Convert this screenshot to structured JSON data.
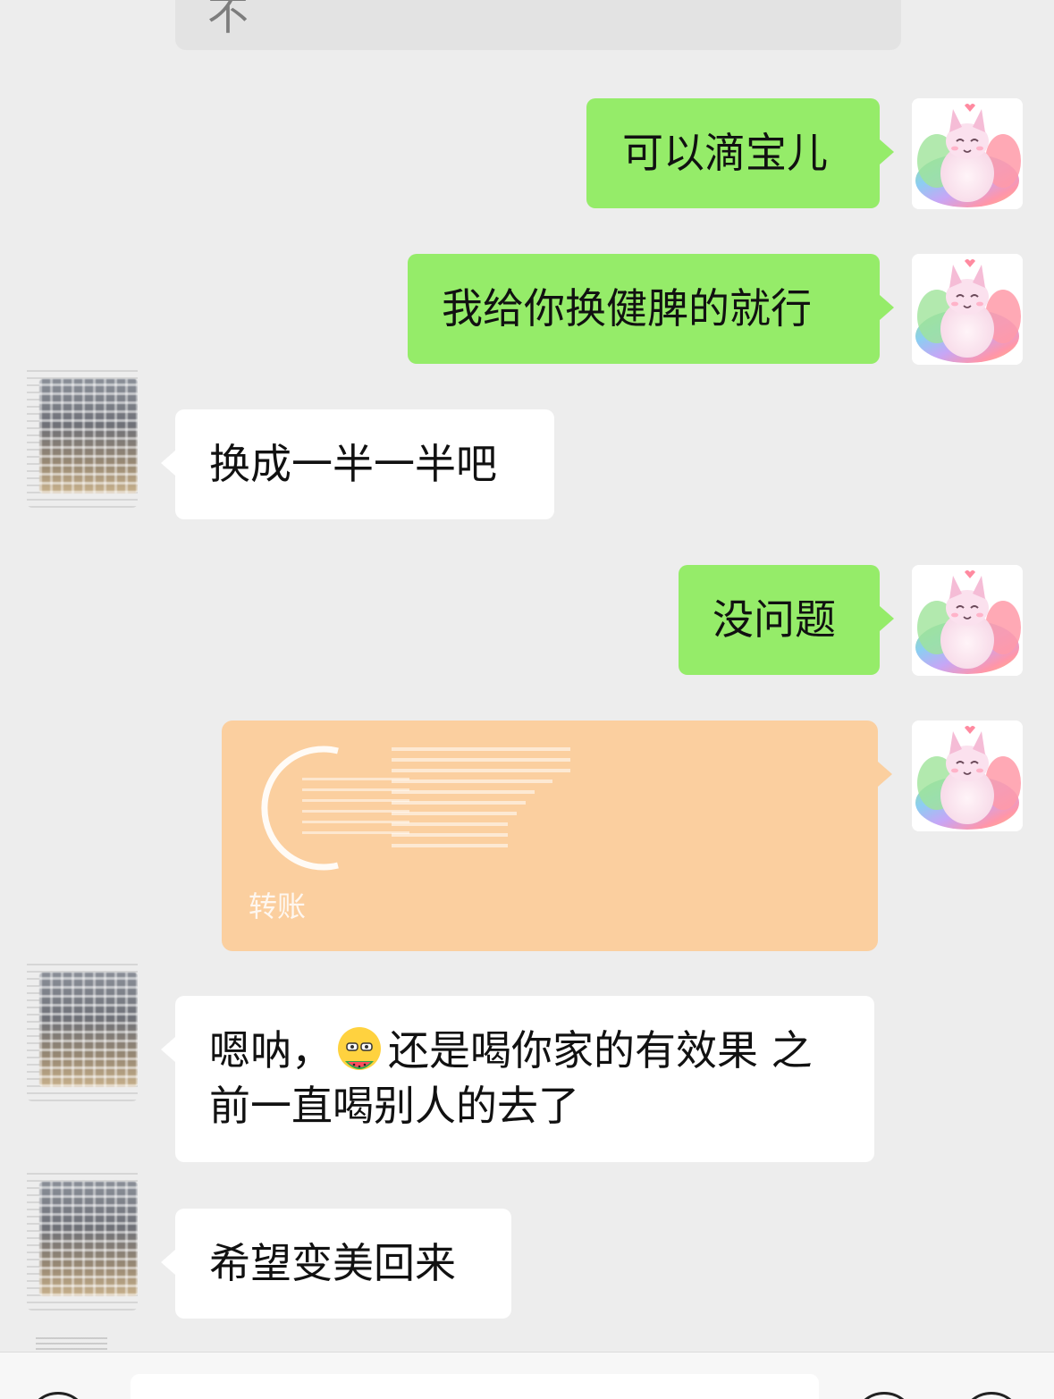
{
  "chat": {
    "top_partial_text": "不",
    "messages": [
      {
        "id": "m1",
        "direction": "out",
        "text": "可以滴宝儿"
      },
      {
        "id": "m2",
        "direction": "out",
        "text": "我给你换健脾的就行"
      },
      {
        "id": "m3",
        "direction": "in",
        "text": "换成一半一半吧"
      },
      {
        "id": "m4",
        "direction": "out",
        "text": "没问题"
      },
      {
        "id": "m5",
        "direction": "out",
        "type": "transfer",
        "label": "转账"
      },
      {
        "id": "m6",
        "direction": "in",
        "text_before_emoji": "嗯呐，",
        "emoji": "eating-watermelon-emoji",
        "text_after_emoji": "还是喝你家的有效果 之前一直喝别人的去了"
      },
      {
        "id": "m7",
        "direction": "in",
        "text": "希望变美回来"
      }
    ]
  },
  "colors": {
    "background": "#ededed",
    "outgoing_bubble": "#95ec69",
    "incoming_bubble": "#ffffff",
    "transfer_card": "#fbcf9f"
  },
  "avatars": {
    "self": "fox-avatar-icon",
    "other": "blurred-avatar-icon"
  },
  "input_bar": {
    "voice_button": "voice-icon",
    "emoji_button": "emoji-icon",
    "more_button": "plus-icon"
  }
}
